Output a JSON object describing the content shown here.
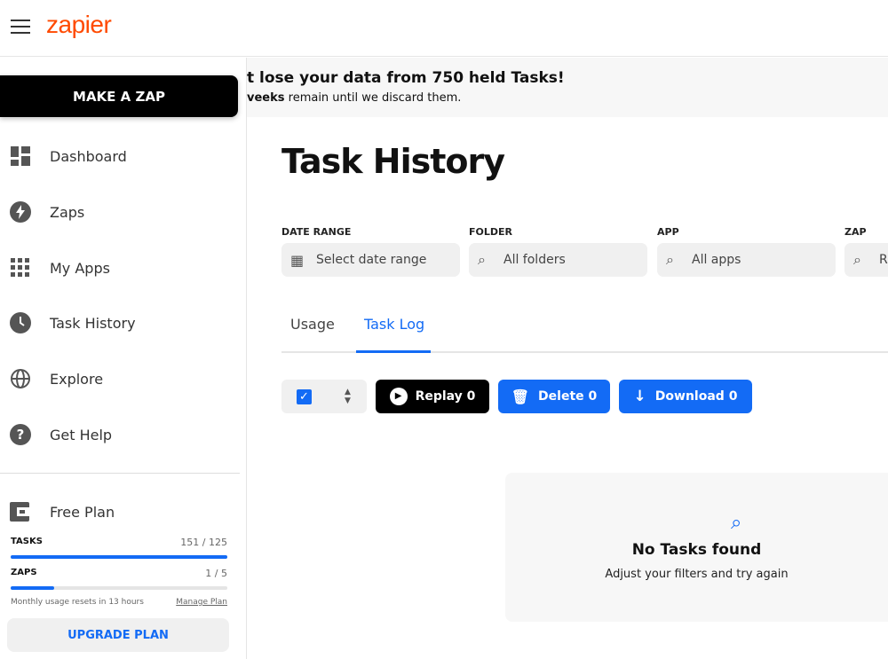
{
  "app": {
    "logo": "zapier"
  },
  "sidebar": {
    "make_zap": "MAKE A ZAP",
    "items": [
      {
        "label": "Dashboard",
        "icon": "dashboard-icon"
      },
      {
        "label": "Zaps",
        "icon": "bolt-icon"
      },
      {
        "label": "My Apps",
        "icon": "grid-icon"
      },
      {
        "label": "Task History",
        "icon": "clock-icon"
      },
      {
        "label": "Explore",
        "icon": "globe-icon"
      },
      {
        "label": "Get Help",
        "icon": "help-icon"
      }
    ],
    "plan": {
      "name": "Free Plan",
      "tasks_label": "TASKS",
      "tasks_value": "151 / 125",
      "tasks_fraction": 1.0,
      "zaps_label": "ZAPS",
      "zaps_value": "1 / 5",
      "zaps_fraction": 0.2,
      "reset_text": "Monthly usage resets in 13 hours",
      "manage": "Manage Plan",
      "upgrade": "UPGRADE PLAN"
    }
  },
  "banner": {
    "title": "t lose your data from 750 held Tasks!",
    "sub_bold": "veeks",
    "sub_rest": " remain until we discard them."
  },
  "main": {
    "title": "Task History",
    "filters": [
      {
        "label": "DATE RANGE",
        "value": "Select date range"
      },
      {
        "label": "FOLDER",
        "value": "All folders"
      },
      {
        "label": "APP",
        "value": "All apps"
      },
      {
        "label": "ZAP",
        "value": "R"
      }
    ],
    "tabs": [
      {
        "label": "Usage"
      },
      {
        "label": "Task Log"
      }
    ],
    "actions": {
      "replay": "Replay 0",
      "delete": "Delete 0",
      "download": "Download 0"
    },
    "empty": {
      "title": "No Tasks found",
      "sub": "Adjust your filters and try again"
    }
  },
  "colors": {
    "accent": "#136bf5",
    "brand": "#ff4a00"
  }
}
